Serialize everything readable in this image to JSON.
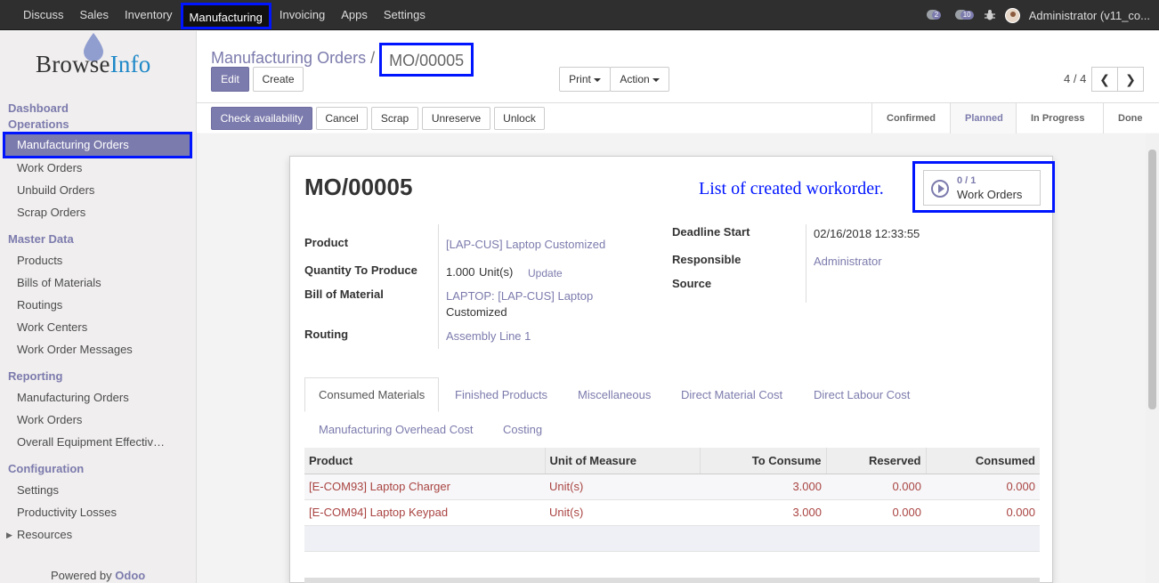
{
  "topnav": {
    "items": [
      "Discuss",
      "Sales",
      "Inventory",
      "Manufacturing",
      "Invoicing",
      "Apps",
      "Settings"
    ],
    "active": "Manufacturing",
    "chat_badge": "2",
    "activity_badge": "10",
    "user": "Administrator (v11_co..."
  },
  "sidebar": {
    "logo": {
      "part1": "Browse",
      "part2": "Info"
    },
    "sections": {
      "dashboard": "Dashboard",
      "operations": "Operations",
      "master_data": "Master Data",
      "reporting": "Reporting",
      "configuration": "Configuration"
    },
    "operations_items": [
      "Manufacturing Orders",
      "Work Orders",
      "Unbuild Orders",
      "Scrap Orders"
    ],
    "master_items": [
      "Products",
      "Bills of Materials",
      "Routings",
      "Work Centers",
      "Work Order Messages"
    ],
    "reporting_items": [
      "Manufacturing Orders",
      "Work Orders",
      "Overall Equipment Effectiv…"
    ],
    "config_items": [
      "Settings",
      "Productivity Losses",
      "Resources"
    ],
    "powered_prefix": "Powered by",
    "powered_brand": "Odoo"
  },
  "breadcrumb": {
    "parent": "Manufacturing Orders",
    "sep": "/",
    "current": "MO/00005"
  },
  "controls": {
    "edit": "Edit",
    "create": "Create",
    "print": "Print",
    "action": "Action",
    "pager": "4 / 4"
  },
  "statusbar": {
    "buttons": [
      "Check availability",
      "Cancel",
      "Scrap",
      "Unreserve",
      "Unlock"
    ],
    "stages": [
      "Confirmed",
      "Planned",
      "In Progress",
      "Done"
    ],
    "current_stage": "Planned"
  },
  "form": {
    "title": "MO/00005",
    "annotation": "List of created workorder.",
    "workorders": {
      "count": "0 / 1",
      "label": "Work Orders"
    },
    "fields": {
      "product_label": "Product",
      "product_value": "[LAP-CUS] Laptop Customized",
      "qty_label": "Quantity To Produce",
      "qty_value": "1.000",
      "qty_uom": "Unit(s)",
      "qty_update": "Update",
      "bom_label": "Bill of Material",
      "bom_value_1": "LAPTOP: [LAP-CUS] Laptop",
      "bom_value_2": "Customized",
      "routing_label": "Routing",
      "routing_value": "Assembly Line 1",
      "deadline_label": "Deadline Start",
      "deadline_value": "02/16/2018 12:33:55",
      "responsible_label": "Responsible",
      "responsible_value": "Administrator",
      "source_label": "Source"
    },
    "tabs": [
      "Consumed Materials",
      "Finished Products",
      "Miscellaneous",
      "Direct Material Cost",
      "Direct Labour Cost",
      "Manufacturing Overhead Cost",
      "Costing"
    ],
    "table": {
      "headers": [
        "Product",
        "Unit of Measure",
        "To Consume",
        "Reserved",
        "Consumed"
      ],
      "rows": [
        [
          "[E-COM93] Laptop Charger",
          "Unit(s)",
          "3.000",
          "0.000",
          "0.000"
        ],
        [
          "[E-COM94] Laptop Keypad",
          "Unit(s)",
          "3.000",
          "0.000",
          "0.000"
        ]
      ]
    }
  },
  "colors": {
    "primary": "#7c7bad",
    "highlight": "#0015ff",
    "navbar": "#2f2f2f",
    "line_text": "#a94442"
  }
}
